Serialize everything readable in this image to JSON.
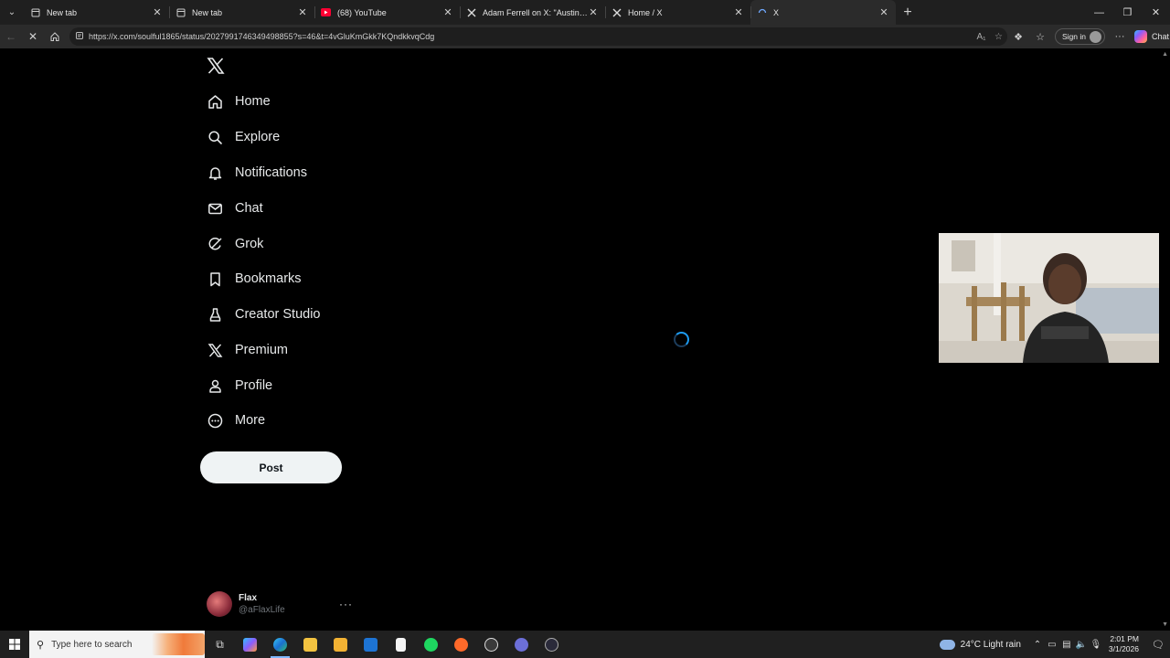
{
  "browser": {
    "tabs": [
      {
        "title": "New tab",
        "favicon": "page-icon"
      },
      {
        "title": "New tab",
        "favicon": "page-icon"
      },
      {
        "title": "(68) YouTube",
        "favicon": "youtube-icon"
      },
      {
        "title": "Adam Ferrell on X: \"Austin Reaves",
        "favicon": "x-icon"
      },
      {
        "title": "Home / X",
        "favicon": "x-icon"
      },
      {
        "title": "X",
        "favicon": "loading-icon",
        "active": true
      }
    ],
    "url": "https://x.com/soulful1865/status/2027991746349498855?s=46&t=4vGluKmGkk7KQndkkvqCdg",
    "signin_label": "Sign in",
    "chat_label": "Chat"
  },
  "sidebar": {
    "items": [
      {
        "label": "Home",
        "icon": "home-icon"
      },
      {
        "label": "Explore",
        "icon": "search-icon"
      },
      {
        "label": "Notifications",
        "icon": "bell-icon"
      },
      {
        "label": "Chat",
        "icon": "mail-icon"
      },
      {
        "label": "Grok",
        "icon": "grok-icon"
      },
      {
        "label": "Bookmarks",
        "icon": "bookmark-icon"
      },
      {
        "label": "Creator Studio",
        "icon": "creator-studio-icon"
      },
      {
        "label": "Premium",
        "icon": "x-icon"
      },
      {
        "label": "Profile",
        "icon": "person-icon"
      },
      {
        "label": "More",
        "icon": "more-circle-icon"
      }
    ],
    "post_label": "Post",
    "account": {
      "name": "Flax",
      "handle": "@aFlaxLife"
    }
  },
  "taskbar": {
    "search_placeholder": "Type here to search",
    "weather": "24°C  Light rain",
    "time": "2:01 PM",
    "date": "3/1/2026"
  },
  "colors": {
    "accent": "#1d9bf0",
    "background": "#000000",
    "text": "#e7e9ea"
  }
}
